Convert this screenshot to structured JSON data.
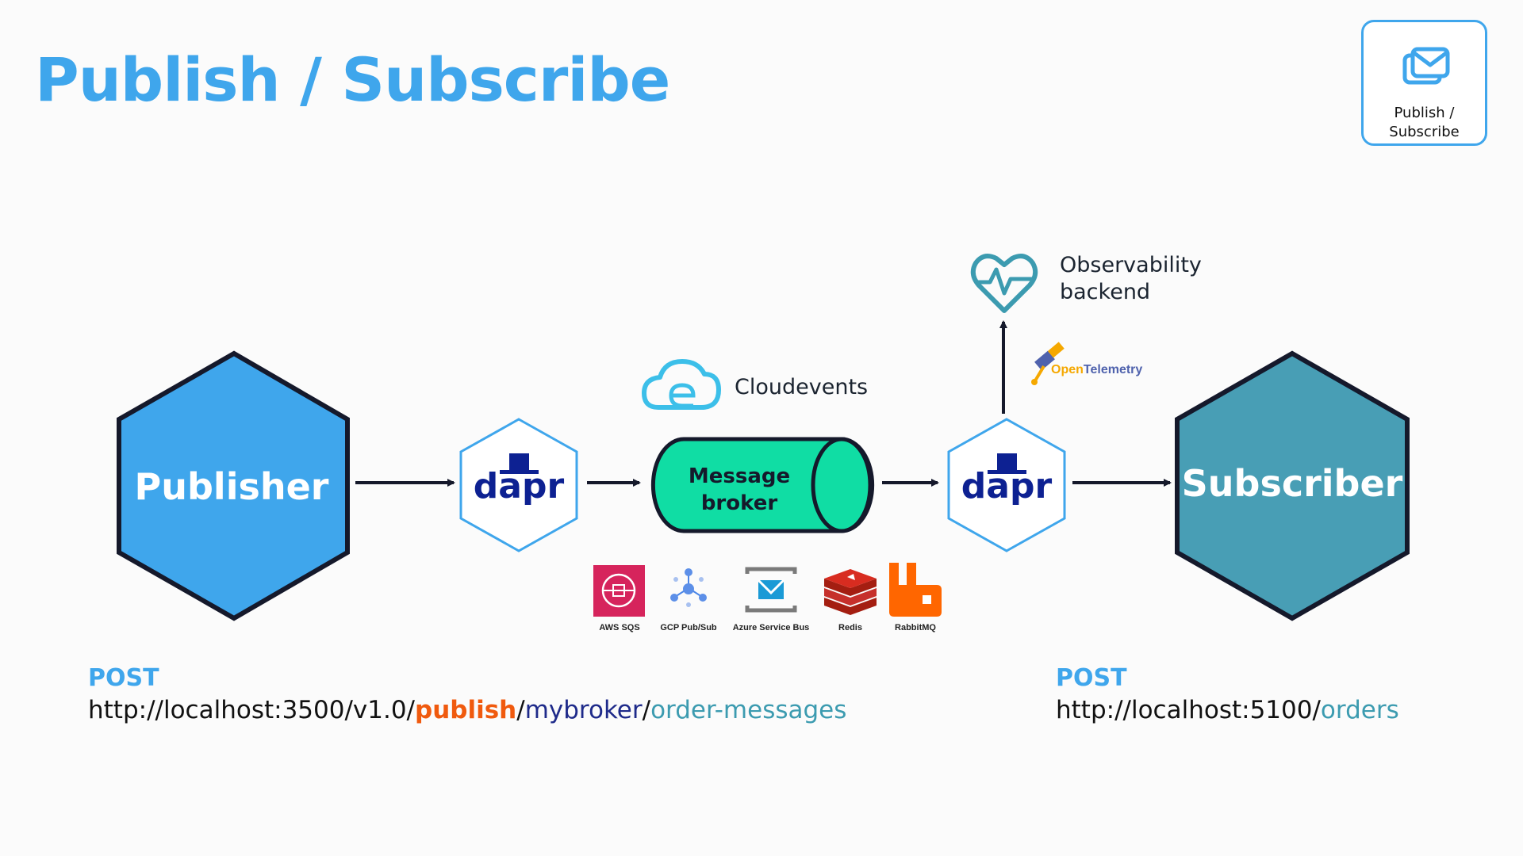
{
  "title": "Publish / Subscribe",
  "badge": {
    "label": "Publish /\nSubscribe",
    "icon": "envelope-icon"
  },
  "nodes": {
    "publisher": "Publisher",
    "subscriber": "Subscriber",
    "dapr_left": "dapr",
    "dapr_right": "dapr",
    "broker": "Message\nbroker"
  },
  "cloudevents": "Cloudevents",
  "observability": "Observability\nbackend",
  "opentelemetry": {
    "prefix": "Open",
    "suffix": "Telemetry"
  },
  "brokers": [
    {
      "label": "AWS SQS",
      "icon": "aws-sqs-icon"
    },
    {
      "label": "GCP Pub/Sub",
      "icon": "gcp-pubsub-icon"
    },
    {
      "label": "Azure Service Bus",
      "icon": "azure-service-bus-icon"
    },
    {
      "label": "Redis",
      "icon": "redis-icon"
    },
    {
      "label": "RabbitMQ",
      "icon": "rabbitmq-icon"
    }
  ],
  "publish_call": {
    "method": "POST",
    "base": "http://localhost:3500/v1.0/",
    "action": "publish",
    "sep1": "/",
    "broker": "mybroker",
    "sep2": "/",
    "topic": "order-messages"
  },
  "subscribe_call": {
    "method": "POST",
    "base": "http://localhost:5100/",
    "route": "orders"
  },
  "colors": {
    "accent": "#3fa6ec",
    "publisher": "#3fa6ec",
    "subscriber": "#489eb5",
    "broker": "#10dda4",
    "dapr_navy": "#0d2192",
    "highlight": "#f05a0e",
    "teal": "#3c9bb0"
  }
}
